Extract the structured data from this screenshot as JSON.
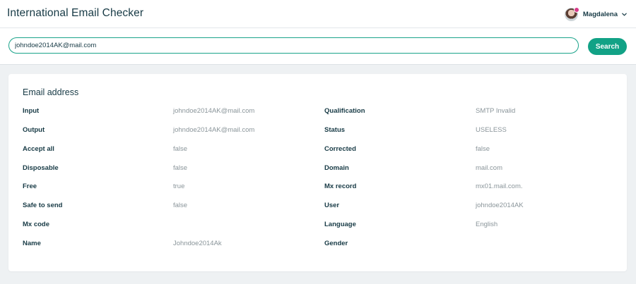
{
  "header": {
    "app_title": "International Email Checker",
    "user_name": "Magdalena"
  },
  "search": {
    "value": "johndoe2014AK@mail.com",
    "button_label": "Search"
  },
  "card": {
    "title": "Email address",
    "left_fields": [
      {
        "label": "Input",
        "value": "johndoe2014AK@mail.com"
      },
      {
        "label": "Output",
        "value": "johndoe2014AK@mail.com"
      },
      {
        "label": "Accept all",
        "value": "false"
      },
      {
        "label": "Disposable",
        "value": "false"
      },
      {
        "label": "Free",
        "value": "true"
      },
      {
        "label": "Safe to send",
        "value": "false"
      },
      {
        "label": "Mx code",
        "value": ""
      },
      {
        "label": "Name",
        "value": "Johndoe2014Ak"
      }
    ],
    "right_fields": [
      {
        "label": "Qualification",
        "value": "SMTP Invalid"
      },
      {
        "label": "Status",
        "value": "USELESS"
      },
      {
        "label": "Corrected",
        "value": "false"
      },
      {
        "label": "Domain",
        "value": "mail.com"
      },
      {
        "label": "Mx record",
        "value": "mx01.mail.com."
      },
      {
        "label": "User",
        "value": "johndoe2014AK"
      },
      {
        "label": "Language",
        "value": "English"
      },
      {
        "label": "Gender",
        "value": ""
      }
    ]
  },
  "colors": {
    "accent": "#12a286",
    "text_dark": "#173a45",
    "text_muted": "#8a959a",
    "avatar_badge": "#d83a8a"
  }
}
